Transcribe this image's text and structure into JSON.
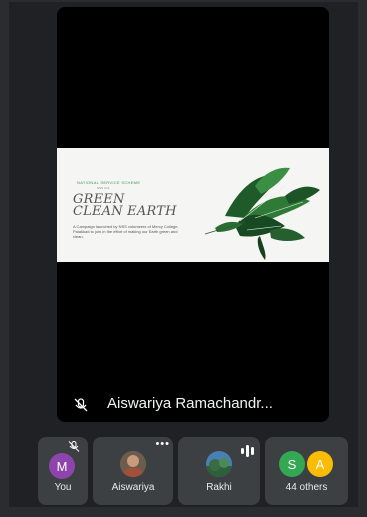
{
  "main_tile": {
    "speaker_name": "Aiswariya Ramachandr...",
    "slide": {
      "kicker": "NATIONAL SERVICE SCHEME",
      "kicker2": "NSS Unit",
      "title_line1": "GREEN",
      "title_line2": "CLEAN EARTH",
      "body": "A Campaign launched by NSS volunteers of Mercy College, Palakkad to join in the effort of making our Earth green and clean."
    }
  },
  "participants": [
    {
      "name": "You",
      "initial": "M",
      "avatar_color": "#8e44ad",
      "muted": true
    },
    {
      "name": "Aiswariya",
      "initial": "",
      "has_more_menu": true
    },
    {
      "name": "Rakhi",
      "initial": "",
      "speaking": true
    },
    {
      "name": "44 others",
      "initials": [
        "S",
        "A"
      ],
      "avatar_colors": [
        "#34a853",
        "#fbbc04"
      ]
    }
  ]
}
